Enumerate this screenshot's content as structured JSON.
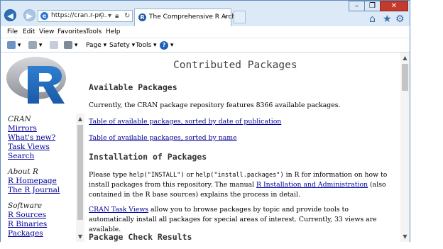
{
  "browser": {
    "url": "https://cran.r-pr...",
    "tab_title": "The Comprehensive R Archi...",
    "tab_close": "×",
    "menus": [
      "File",
      "Edit",
      "View",
      "Favorites",
      "Tools",
      "Help"
    ],
    "commands": {
      "page": "Page",
      "safety": "Safety",
      "tools": "Tools"
    },
    "window_controls": {
      "minimize": "–",
      "maximize": "❐",
      "close": "✕"
    },
    "icons": [
      "home-icon",
      "favorites-star-icon",
      "settings-gear-icon",
      "rss-feed-icon",
      "read-mail-icon",
      "print-icon",
      "help-icon",
      "search-icon",
      "lock-icon",
      "refresh-icon"
    ]
  },
  "sidebar": {
    "logo": "R",
    "sections": [
      {
        "heading": "CRAN",
        "links": [
          "Mirrors",
          "What's new?",
          "Task Views",
          "Search"
        ]
      },
      {
        "heading": "About R",
        "links": [
          "R Homepage",
          "The R Journal"
        ]
      },
      {
        "heading": "Software",
        "links": [
          "R Sources",
          "R Binaries",
          "Packages"
        ]
      }
    ]
  },
  "page": {
    "title": "Contributed Packages",
    "available_heading": "Available Packages",
    "available_text": "Currently, the CRAN package repository features 8366 available packages.",
    "link_by_date": "Table of available packages, sorted by date of publication",
    "link_by_name": "Table of available packages, sorted by name",
    "install_heading": "Installation of Packages",
    "install_p": {
      "pre": "Please type ",
      "code1": "help(\"INSTALL\")",
      "mid1": " or ",
      "code2": "help(\"install.packages\")",
      "mid2": " in R for information on how to install packages from this repository. The manual ",
      "link": "R Installation and Administration",
      "post": " (also contained in the R base sources) explains the process in detail."
    },
    "taskviews_p": {
      "link": "CRAN Task Views",
      "text": " allow you to browse packages by topic and provide tools to automatically install all packages for special areas of interest. Currently, 33 views are available."
    },
    "next_heading_partial": "Package Check Results"
  }
}
